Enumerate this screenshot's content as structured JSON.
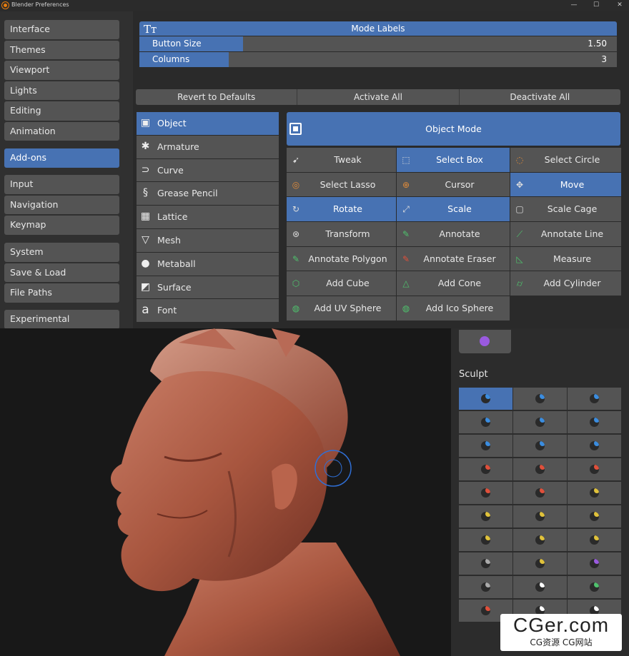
{
  "window": {
    "title": "Blender Preferences",
    "minimize": "—",
    "maximize": "☐",
    "close": "✕"
  },
  "nav": {
    "group1": [
      "Interface",
      "Themes",
      "Viewport",
      "Lights",
      "Editing",
      "Animation"
    ],
    "addons": "Add-ons",
    "group2": [
      "Input",
      "Navigation",
      "Keymap"
    ],
    "group3": [
      "System",
      "Save & Load",
      "File Paths"
    ],
    "experimental": "Experimental"
  },
  "mode_labels": {
    "header": "Mode Labels",
    "header_icon": "text-icon",
    "button_size": {
      "label": "Button Size",
      "value": "1.50"
    },
    "columns": {
      "label": "Columns",
      "value": "3"
    }
  },
  "actions": [
    "Revert to Defaults",
    "Activate All",
    "Deactivate All"
  ],
  "object_types": [
    {
      "label": "Object",
      "icon": "object-icon",
      "active": true
    },
    {
      "label": "Armature",
      "icon": "armature-icon"
    },
    {
      "label": "Curve",
      "icon": "curve-icon"
    },
    {
      "label": "Grease Pencil",
      "icon": "grease-pencil-icon"
    },
    {
      "label": "Lattice",
      "icon": "lattice-icon"
    },
    {
      "label": "Mesh",
      "icon": "mesh-icon"
    },
    {
      "label": "Metaball",
      "icon": "metaball-icon"
    },
    {
      "label": "Surface",
      "icon": "surface-icon"
    },
    {
      "label": "Font",
      "icon": "font-icon"
    }
  ],
  "object_mode": "Object Mode",
  "tools": [
    {
      "label": "Tweak",
      "icon": "tweak-icon"
    },
    {
      "label": "Select Box",
      "icon": "select-box-icon",
      "active": true
    },
    {
      "label": "Select Circle",
      "icon": "select-circle-icon"
    },
    {
      "label": "Select Lasso",
      "icon": "select-lasso-icon"
    },
    {
      "label": "Cursor",
      "icon": "cursor-icon"
    },
    {
      "label": "Move",
      "icon": "move-icon",
      "active": true
    },
    {
      "label": "Rotate",
      "icon": "rotate-icon",
      "active": true
    },
    {
      "label": "Scale",
      "icon": "scale-icon",
      "active": true
    },
    {
      "label": "Scale Cage",
      "icon": "scale-cage-icon"
    },
    {
      "label": "Transform",
      "icon": "transform-icon"
    },
    {
      "label": "Annotate",
      "icon": "annotate-icon"
    },
    {
      "label": "Annotate Line",
      "icon": "annotate-line-icon"
    },
    {
      "label": "Annotate Polygon",
      "icon": "annotate-polygon-icon"
    },
    {
      "label": "Annotate Eraser",
      "icon": "annotate-eraser-icon"
    },
    {
      "label": "Measure",
      "icon": "measure-icon"
    },
    {
      "label": "Add Cube",
      "icon": "add-cube-icon"
    },
    {
      "label": "Add Cone",
      "icon": "add-cone-icon"
    },
    {
      "label": "Add Cylinder",
      "icon": "add-cylinder-icon"
    },
    {
      "label": "Add UV Sphere",
      "icon": "add-uv-sphere-icon"
    },
    {
      "label": "Add Ico Sphere",
      "icon": "add-ico-sphere-icon"
    }
  ],
  "sculpt": {
    "label": "Sculpt",
    "accent": "#4772b3",
    "brush_colors": [
      "#3b8de0",
      "#3b8de0",
      "#3b8de0",
      "#3b8de0",
      "#3b8de0",
      "#3b8de0",
      "#3b8de0",
      "#3b8de0",
      "#3b8de0",
      "#e0503b",
      "#e0503b",
      "#e0503b",
      "#e0503b",
      "#e0503b",
      "#e0c23b",
      "#e0c23b",
      "#e0c23b",
      "#e0c23b",
      "#e0c23b",
      "#e0c23b",
      "#e0c23b",
      "#aaaaaa",
      "#e0c23b",
      "#9a5ae0",
      "#aaaaaa",
      "#ffffff",
      "#4fc26d",
      "#e0503b",
      "#ffffff",
      "#ffffff"
    ]
  },
  "watermark": {
    "line1": "CGer.com",
    "line2": "CG资源 CG网站"
  }
}
